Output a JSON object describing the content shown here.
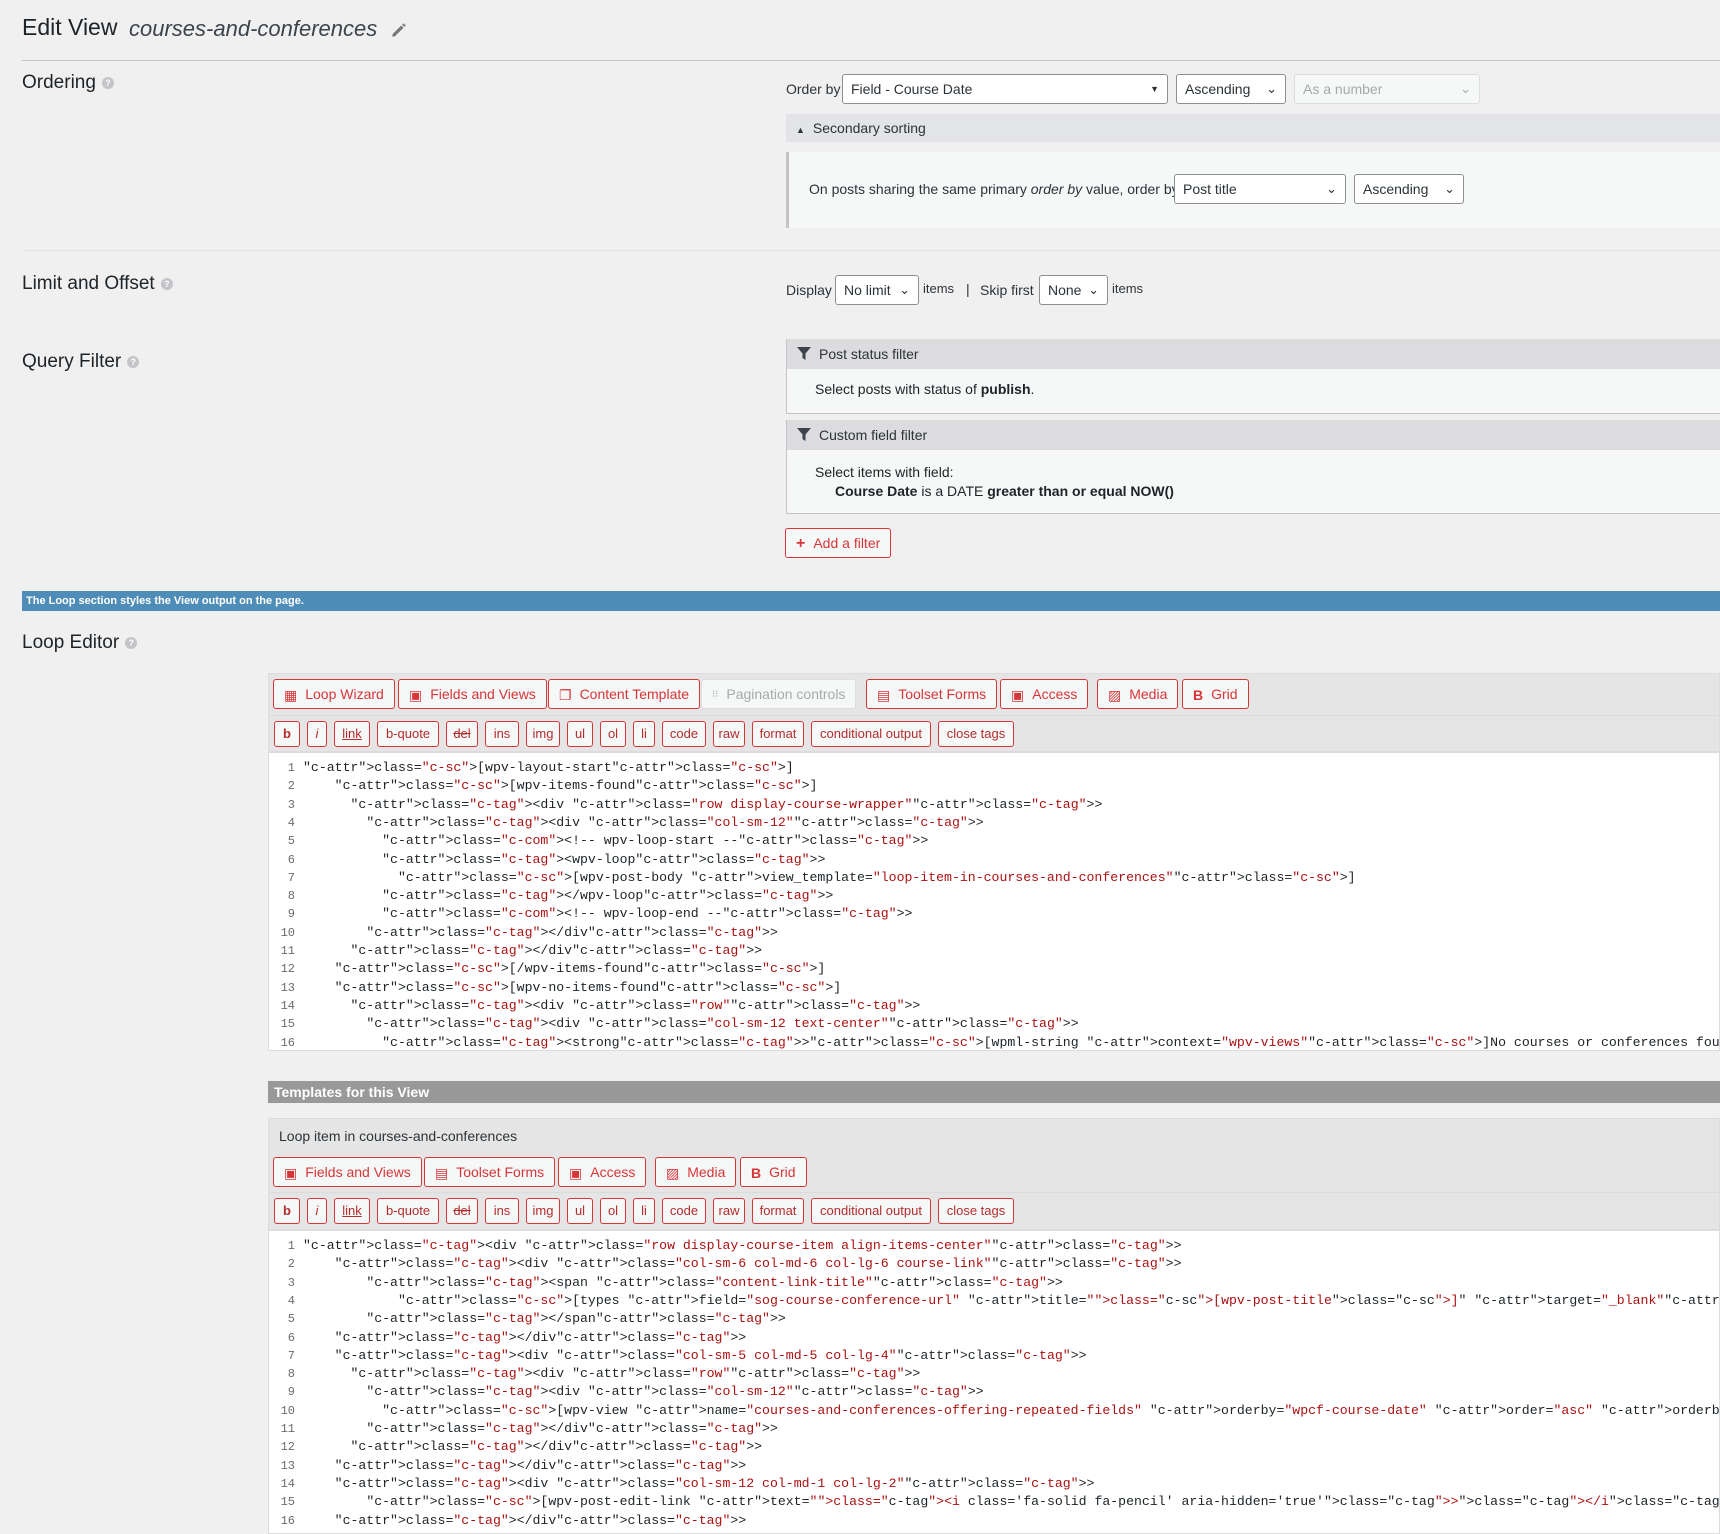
{
  "header": {
    "title": "Edit View",
    "view_name": "courses-and-conferences"
  },
  "ordering": {
    "title": "Ordering",
    "order_by_label": "Order by",
    "order_by_value": "Field - Course Date",
    "direction": "Ascending",
    "as_type": "As a number",
    "secondary_toggle": "Secondary sorting",
    "secondary_text_1": "On posts sharing the same primary ",
    "secondary_text_em": "order by",
    "secondary_text_2": " value, order by",
    "secondary_order_by": "Post title",
    "secondary_direction": "Ascending"
  },
  "limit": {
    "title": "Limit and Offset",
    "display_label": "Display",
    "display_value": "No limit",
    "items_1": "items",
    "separator": "|",
    "skip_label": "Skip first",
    "skip_value": "None",
    "items_2": "items"
  },
  "query_filter": {
    "title": "Query Filter",
    "post_status": {
      "title": "Post status filter",
      "text": "Select posts with status of ",
      "value": "publish",
      "end": "."
    },
    "custom_field": {
      "title": "Custom field filter",
      "line1": "Select items with field:",
      "field": "Course Date",
      "middle": " is a DATE ",
      "condition": "greater than or equal NOW()"
    },
    "add_filter": "Add a filter"
  },
  "banner": "The Loop section styles the View output on the page.",
  "loop_editor": {
    "title": "Loop Editor",
    "toolbar": [
      "Loop Wizard",
      "Fields and Views",
      "Content Template",
      "Pagination controls",
      "Toolset Forms",
      "Access",
      "Media",
      "Grid"
    ],
    "tags": [
      "b",
      "i",
      "link",
      "b-quote",
      "del",
      "ins",
      "img",
      "ul",
      "ol",
      "li",
      "code",
      "raw",
      "format",
      "conditional output",
      "close tags"
    ],
    "code": [
      "[wpv-layout-start]",
      "    [wpv-items-found]",
      "      <div class=\"row display-course-wrapper\">",
      "        <div class=\"col-sm-12\">",
      "          <!-- wpv-loop-start -->",
      "          <wpv-loop>",
      "            [wpv-post-body view_template=\"loop-item-in-courses-and-conferences\"]",
      "          </wpv-loop>",
      "          <!-- wpv-loop-end -->",
      "        </div>",
      "      </div>",
      "    [/wpv-items-found]",
      "    [wpv-no-items-found]",
      "      <div class=\"row\">",
      "        <div class=\"col-sm-12 text-center\">",
      "          <strong>[wpml-string context=\"wpv-views\"]No courses or conferences found at this time.[/wpml-string]</strong>"
    ]
  },
  "templates": {
    "bar": "Templates for this View",
    "item_title": "Loop item in courses-and-conferences",
    "toolbar": [
      "Fields and Views",
      "Toolset Forms",
      "Access",
      "Media",
      "Grid"
    ],
    "code": [
      "<div class=\"row display-course-item align-items-center\">",
      "    <div class=\"col-sm-6 col-md-6 col-lg-6 course-link\">",
      "        <span class=\"content-link-title\">",
      "            [types field=\"sog-course-conference-url\" title=\"[wpv-post-title]\" target=\"_blank\"][/types]",
      "        </span>",
      "    </div>",
      "    <div class=\"col-sm-5 col-md-5 col-lg-4\">",
      "      <div class=\"row\">",
      "        <div class=\"col-sm-12\">",
      "          [wpv-view name=\"courses-and-conferences-offering-repeated-fields\" orderby=\"wpcf-course-date\" order=\"asc\" orderby_second=\"post_title\" order_second=\"asc\"]",
      "        </div>",
      "      </div>",
      "    </div>",
      "    <div class=\"col-sm-12 col-md-1 col-lg-2\">",
      "        [wpv-post-edit-link text=\"<i class='fa-solid fa-pencil' aria-hidden='true'></i>Edit\" class=\"btn btn-admin btn-block\"]",
      "    </div>"
    ]
  }
}
